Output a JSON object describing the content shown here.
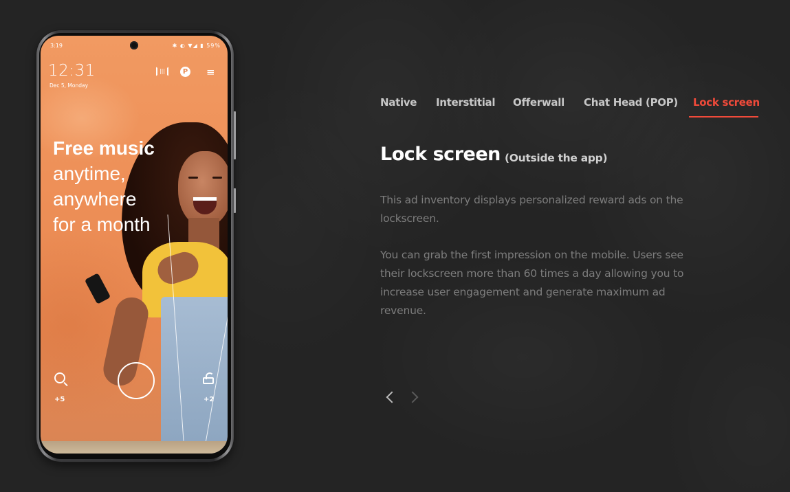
{
  "phone": {
    "status_time": "3:19",
    "status_icons": "✱ ◐ ▼◢ ▮ 59%",
    "battery": "59%",
    "clock": "12:31",
    "date": "Dec 5, Monday",
    "scan_icon": "scan-icon",
    "point_icon_label": "P",
    "menu_icon": "≡",
    "headline": {
      "line1": "Free music",
      "line2": "anytime,",
      "line3": "anywhere",
      "line4": "for a month"
    },
    "left_count": "+5",
    "right_count": "+2"
  },
  "tabs": [
    {
      "label": "Native",
      "active": false
    },
    {
      "label": "Interstitial",
      "active": false
    },
    {
      "label": "Offerwall",
      "active": false
    },
    {
      "label": "Chat Head (POP)",
      "active": false
    },
    {
      "label": "Lock screen",
      "active": true
    }
  ],
  "content": {
    "title": "Lock screen",
    "subtitle": "(Outside the app)",
    "paragraph1": "This ad inventory displays personalized reward ads on the lockscreen.",
    "paragraph2": "You can grab the first impression on the mobile. Users see their lockscreen more than 60 times a day allowing you to increase user engagement and generate maximum ad revenue."
  },
  "colors": {
    "accent": "#f04a3a",
    "background": "#242424",
    "tab_text": "#c7c7c7",
    "body_text": "#7d7d7d"
  }
}
